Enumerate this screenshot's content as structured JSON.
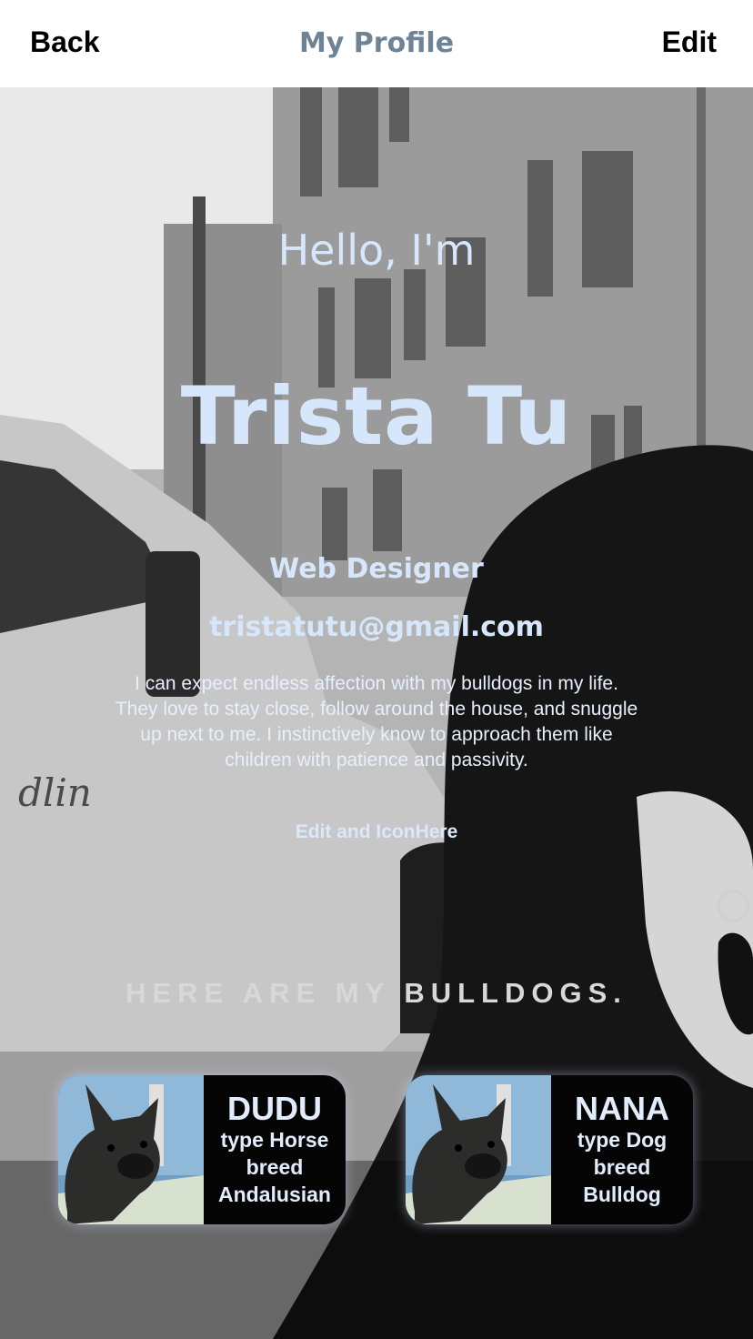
{
  "header": {
    "back_label": "Back",
    "title": "My Profile",
    "edit_label": "Edit"
  },
  "profile": {
    "greeting": "Hello, I'm",
    "name": "Trista Tu",
    "job_title": "Web Designer",
    "email": "tristatutu@gmail.com",
    "bio": "I can expect endless affection with my bulldogs in my life. They love to stay close, follow around the house, and snuggle up next to me. I instinctively know to approach them like children with patience and passivity.",
    "edit_icon_text": "Edit and IconHere"
  },
  "dogs_section": {
    "heading": "HERE ARE MY BULLDOGS.",
    "dogs": [
      {
        "name": "DUDU",
        "type_line": "type Horse",
        "breed_label": "breed",
        "breed": "Andalusian"
      },
      {
        "name": "NANA",
        "type_line": "type Dog",
        "breed_label": "breed",
        "breed": "Bulldog"
      }
    ]
  },
  "colors": {
    "accent_text": "#d6e6fb",
    "title_gray_blue": "#6f8396",
    "card_bg": "#050505"
  }
}
